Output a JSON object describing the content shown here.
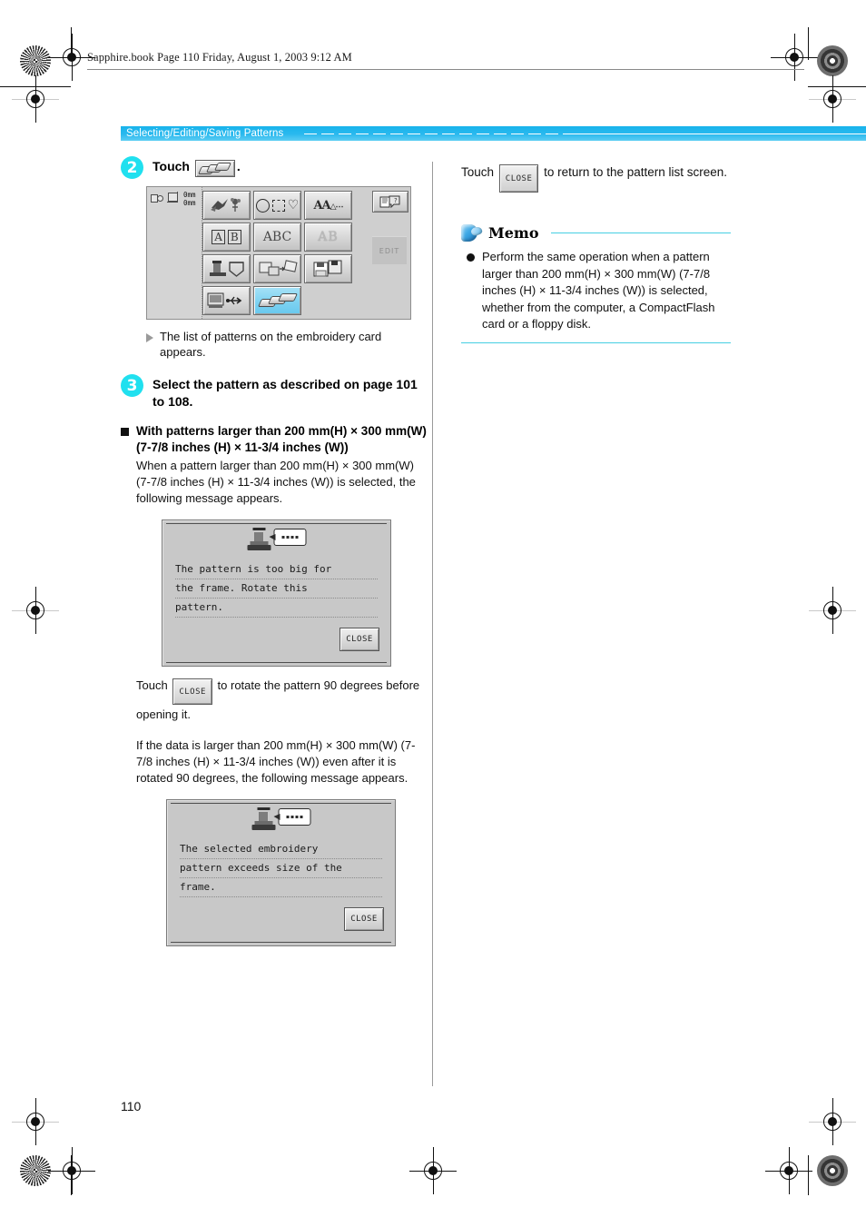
{
  "meta": {
    "book_line": "Sapphire.book  Page 110  Friday, August 1, 2003  9:12 AM",
    "page_number": "110"
  },
  "section_header": {
    "title": "Selecting/Editing/Saving Patterns"
  },
  "left_column": {
    "step2": {
      "number": "2",
      "text_before": "Touch",
      "text_after": ".",
      "key_icon": "embroidery-card-icon"
    },
    "machine_screen": {
      "dimension_1": "0mm",
      "dimension_2": "0mm",
      "edit_tab_label": "EDIT",
      "buttons": [
        {
          "name": "embroidery-patterns",
          "glyph": "birds-flowers",
          "selected": false
        },
        {
          "name": "frame-patterns",
          "glyph": "circle-square-heart",
          "selected": false
        },
        {
          "name": "character-patterns",
          "glyph": "AAA",
          "selected": false
        },
        {
          "name": "decorative-alphabet",
          "glyph": "framed-AB",
          "selected": false
        },
        {
          "name": "floral-alphabet",
          "glyph": "ABC",
          "selected": false
        },
        {
          "name": "outline-alphabet",
          "glyph": "outline-AB",
          "selected": false
        },
        {
          "name": "utility-patterns",
          "glyph": "machine-pocket",
          "selected": false
        },
        {
          "name": "card-patterns",
          "glyph": "card-transfer",
          "selected": false
        },
        {
          "name": "memory-patterns",
          "glyph": "floppy-disk",
          "selected": false
        },
        {
          "name": "computer-usb",
          "glyph": "computer-usb",
          "selected": false
        },
        {
          "name": "embroidery-card",
          "glyph": "card-stack",
          "selected": true
        }
      ],
      "help_button": "manual-help-icon"
    },
    "result_note": "The list of patterns on the embroidery card appears.",
    "step3": {
      "number": "3",
      "text": "Select the pattern as described on page 101 to 108."
    },
    "subsection": {
      "heading_line1": "With patterns larger than 200 mm(H) × 300 mm(W)",
      "heading_line2": "(7-7/8 inches (H) × 11-3/4 inches (W))",
      "body": "When a pattern larger than 200 mm(H) × 300 mm(W) (7-7/8 inches (H) × 11-3/4 inches (W)) is selected, the following message appears."
    },
    "dialog1": {
      "line1": "The pattern is too big for",
      "line2": "the frame. Rotate this",
      "line3": "pattern.",
      "close_label": "CLOSE",
      "icon": "sewing-machine-speech-icon"
    },
    "after_dialog1": {
      "prefix": "Touch",
      "key_label": "CLOSE",
      "suffix": "to rotate the pattern 90 degrees before opening it."
    },
    "paragraph2": "If the data is larger than 200 mm(H) × 300 mm(W) (7-7/8 inches (H) × 11-3/4 inches (W)) even after it is rotated 90 degrees, the following message appears.",
    "dialog2": {
      "line1": "The selected embroidery",
      "line2": "pattern exceeds size of the",
      "line3": "frame.",
      "close_label": "CLOSE",
      "icon": "sewing-machine-speech-icon"
    }
  },
  "right_column": {
    "touch_line": {
      "prefix": "Touch",
      "key_label": "CLOSE",
      "suffix": "to return to the pattern list screen."
    },
    "memo": {
      "title": "Memo",
      "text": "Perform the same operation when a pattern larger than 200 mm(H) × 300 mm(W) (7-7/8 inches (H) × 11-3/4 inches (W)) is selected, whether from the computer, a CompactFlash card or a floppy disk.",
      "icon": "memo-nib-icon",
      "accent_color": "#46cfe2"
    }
  },
  "colors": {
    "section_bar": "#2ab9ee",
    "step_badge": "#20e0ef",
    "selected_button": "#7ed2f1",
    "memo_rule": "#46cfe2"
  }
}
